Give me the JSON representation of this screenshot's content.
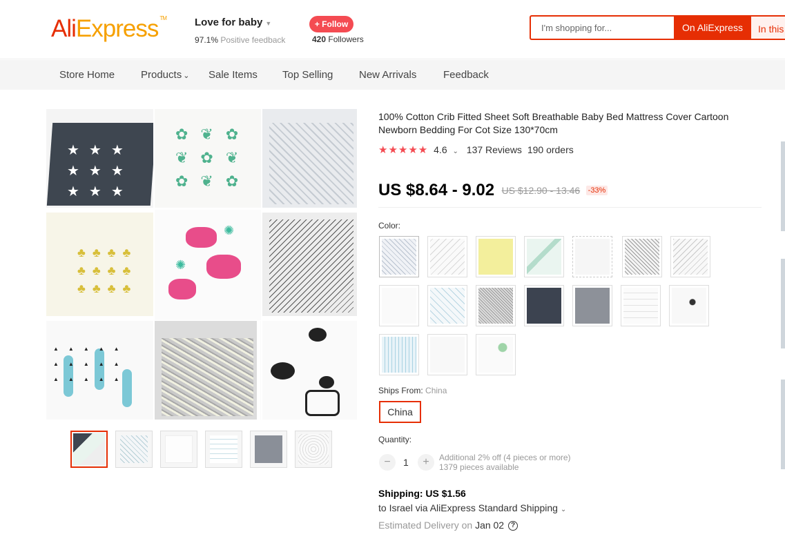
{
  "header": {
    "logo_ali": "Ali",
    "logo_express": "Express",
    "logo_tm": "TM",
    "store_name": "Love for baby",
    "feedback_pct": "97.1%",
    "feedback_text": "Positive feedback",
    "follow_label": "+ Follow",
    "followers_count": "420",
    "followers_text": "Followers",
    "search_placeholder": "I'm shopping for...",
    "search_ae_label": "On AliExpress",
    "search_store_label": "In this"
  },
  "nav": {
    "items": [
      "Store Home",
      "Products",
      "Sale Items",
      "Top Selling",
      "New Arrivals",
      "Feedback"
    ]
  },
  "product": {
    "title": "100% Cotton Crib Fitted Sheet Soft Breathable Baby Bed Mattress Cover Cartoon Newborn Bedding For Cot Size 130*70cm",
    "stars": "★★★★★",
    "rating": "4.6",
    "reviews": "137 Reviews",
    "orders": "190 orders",
    "price": "US $8.64 - 9.02",
    "orig_price": "US $12.90 - 13.46",
    "discount": "-33%",
    "color_label": "Color:",
    "ships_from_label": "Ships From:",
    "ships_from_value": "China",
    "ship_option": "China",
    "quantity_label": "Quantity:",
    "quantity": "1",
    "qty_minus": "−",
    "qty_plus": "+",
    "additional_off": "Additional 2% off (4 pieces or more)",
    "available": "1379 pieces available",
    "shipping": "Shipping: US $1.56",
    "ship_via": "to Israel via AliExpress Standard Shipping",
    "est_label": "Estimated Delivery on",
    "est_date": "Jan 02",
    "help": "?"
  },
  "colors": {
    "brand_red": "#e62e04",
    "star_red": "#f44b52"
  }
}
